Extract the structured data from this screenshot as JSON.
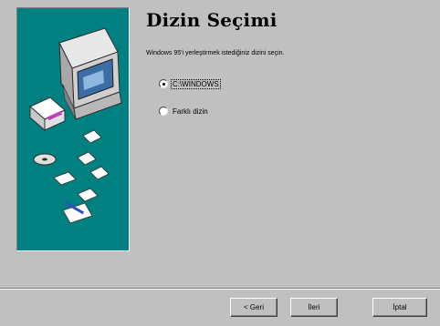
{
  "wizard": {
    "title": "Dizin Seçimi",
    "instruction": "Windows 95'i yerleştirmek istediğiniz dizini seçin.",
    "options": [
      {
        "label": "C:\\WINDOWS",
        "checked": true
      },
      {
        "label": "Farklı dizin",
        "checked": false
      }
    ]
  },
  "buttons": {
    "back": "< Geri",
    "next": "İleri",
    "cancel": "İptal"
  },
  "colors": {
    "dialog_bg": "#c0c0c0",
    "wizard_panel": "#008080"
  }
}
